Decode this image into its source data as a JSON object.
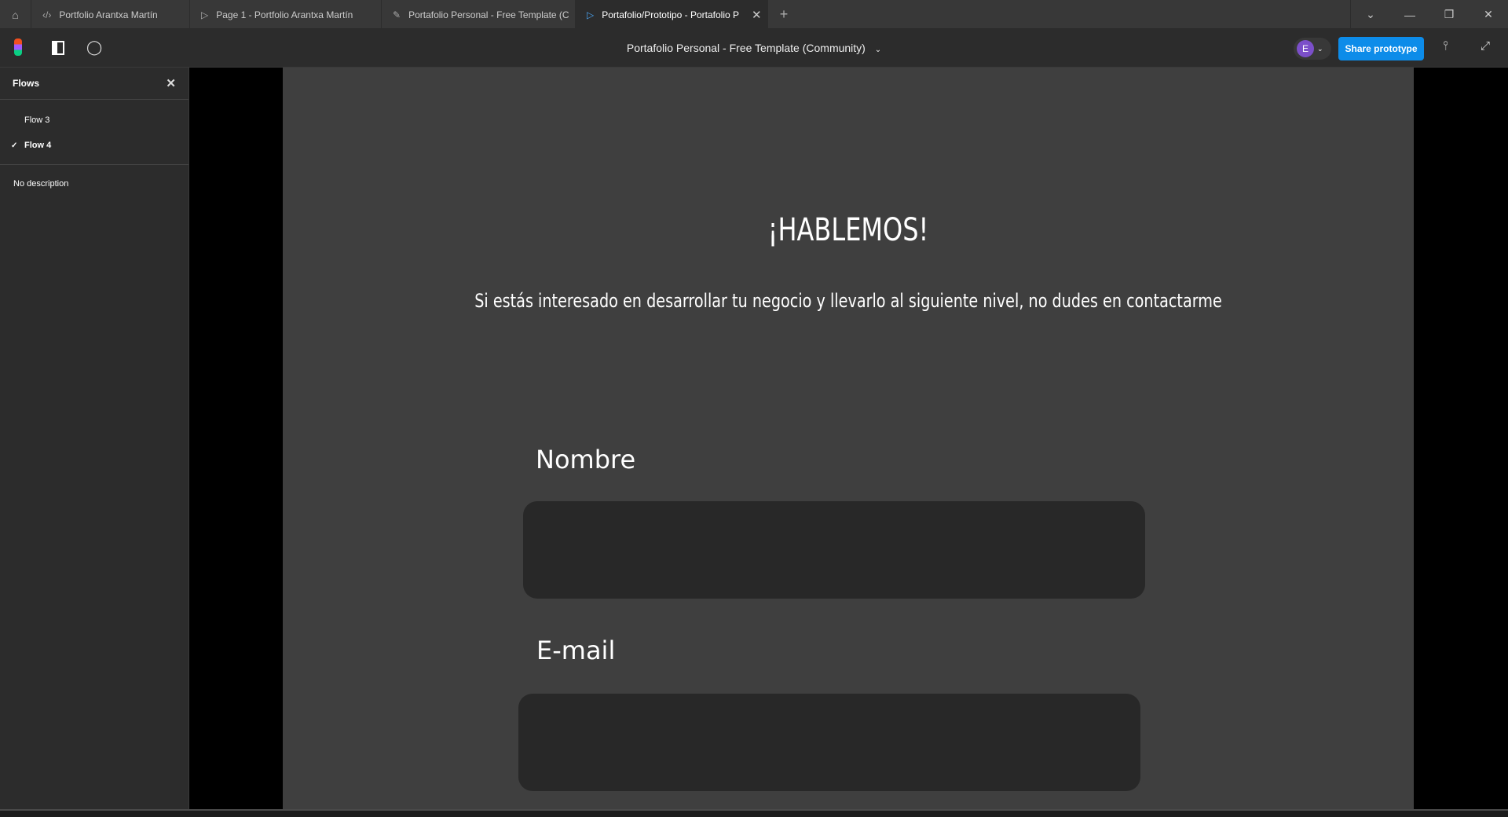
{
  "tabs": [
    {
      "label": "Portfolio Arantxa Martín",
      "icon": "code-icon"
    },
    {
      "label": "Page 1 - Portfolio Arantxa Martín",
      "icon": "play-icon"
    },
    {
      "label": "Portafolio Personal - Free Template (C",
      "icon": "draft-icon"
    },
    {
      "label": "Portafolio/Prototipo - Portafolio P",
      "icon": "play-icon",
      "active": true
    }
  ],
  "toolbar": {
    "title": "Portafolio Personal - Free Template (Community)",
    "avatar_initial": "E",
    "share_label": "Share prototype",
    "accent": "#0d8ce9"
  },
  "sidebar": {
    "title": "Flows",
    "flows": [
      {
        "label": "Flow 3",
        "selected": false
      },
      {
        "label": "Flow 4",
        "selected": true
      }
    ],
    "description": "No description"
  },
  "frame": {
    "heading": "¡HABLEMOS!",
    "subtitle": "Si estás interesado en desarrollar tu negocio y llevarlo al siguiente nivel, no dudes en contactarme",
    "fields": [
      {
        "label": "Nombre",
        "value": ""
      },
      {
        "label": "E-mail",
        "value": ""
      }
    ]
  }
}
